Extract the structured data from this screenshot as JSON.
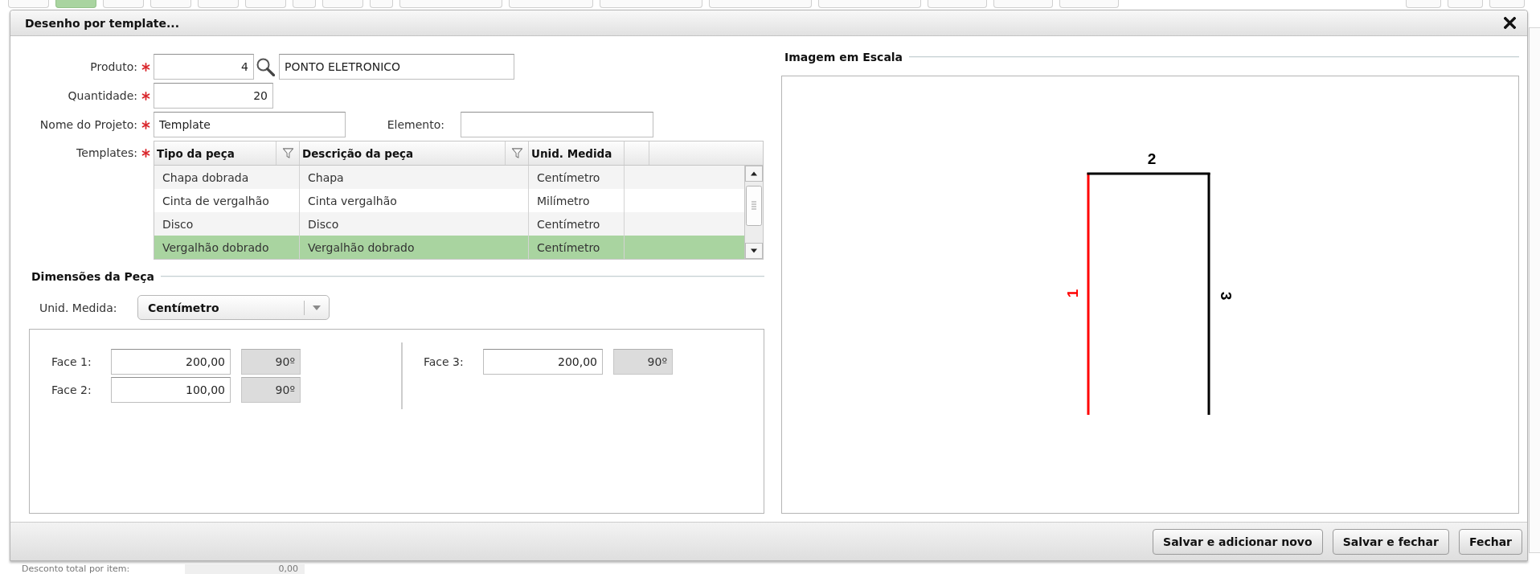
{
  "page": {
    "toolbar_buttons": [
      {
        "selected": false
      },
      {
        "selected": true
      },
      {
        "selected": false
      },
      {
        "selected": false
      },
      {
        "selected": false
      },
      {
        "selected": false
      },
      {
        "selected": false
      },
      {
        "selected": false
      },
      {
        "selected": false
      },
      {
        "selected": false
      },
      {
        "selected": false
      },
      {
        "selected": false
      },
      {
        "selected": false
      },
      {
        "selected": false
      },
      {
        "selected": false
      },
      {
        "selected": false
      },
      {
        "selected": false
      },
      {
        "selected": false
      },
      {
        "selected": false
      },
      {
        "selected": false
      }
    ],
    "discount_label": "Desconto total por item:",
    "discount_value": "0,00"
  },
  "dialog": {
    "title": "Desenho por template..."
  },
  "form": {
    "product": {
      "label": "Produto:",
      "required": true,
      "code": "4",
      "name": "PONTO ELETRONICO"
    },
    "quantity": {
      "label": "Quantidade:",
      "required": true,
      "value": "20"
    },
    "project_name": {
      "label": "Nome do Projeto:",
      "required": true,
      "value": "Template"
    },
    "element": {
      "label": "Elemento:"
    },
    "templates": {
      "label": "Templates:",
      "required": true,
      "columns": [
        {
          "label": "Tipo da peça",
          "filter": true
        },
        {
          "label": "Descrição da peça",
          "filter": true
        },
        {
          "label": "Unid. Medida",
          "filter": false
        }
      ],
      "rows": [
        {
          "cells": [
            "Chapa dobrada",
            "Chapa",
            "Centímetro"
          ],
          "selected": false
        },
        {
          "cells": [
            "Cinta de vergalhão",
            "Cinta vergalhão",
            "Milímetro"
          ],
          "selected": false
        },
        {
          "cells": [
            "Disco",
            "Disco",
            "Centímetro"
          ],
          "selected": false
        },
        {
          "cells": [
            "Vergalhão dobrado",
            "Vergalhão dobrado",
            "Centímetro"
          ],
          "selected": true
        }
      ]
    }
  },
  "dimensions": {
    "title": "Dimensões da Peça",
    "unit": {
      "label": "Unid. Medida:",
      "value": "Centímetro"
    },
    "face_columns": [
      {
        "faces": [
          {
            "label": "Face 1:",
            "length": "200,00",
            "angle": "90º",
            "angle_disabled": true
          },
          {
            "label": "Face 2:",
            "length": "100,00",
            "angle": "90º",
            "angle_disabled": true
          }
        ]
      },
      {
        "faces": [
          {
            "label": "Face 3:",
            "length": "200,00",
            "angle": "90º",
            "angle_disabled": true
          }
        ]
      }
    ]
  },
  "scale_image": {
    "title": "Imagem em Escala",
    "segments": [
      {
        "label": "1",
        "color": "#ff0000"
      },
      {
        "label": "2",
        "color": "#000000"
      },
      {
        "label": "3",
        "color": "#000000"
      }
    ]
  },
  "buttons": [
    "Salvar e adicionar novo",
    "Salvar e fechar",
    "Fechar"
  ]
}
